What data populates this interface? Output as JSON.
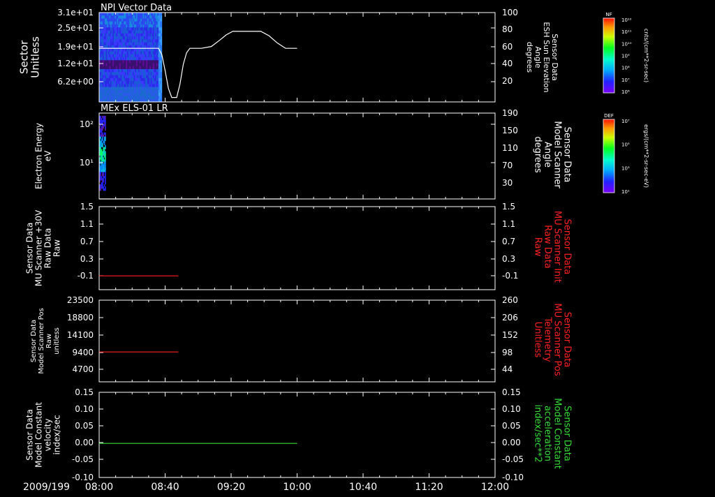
{
  "chart_data": [
    {
      "type": "heatmap",
      "title": "NPI Vector Data",
      "ylabel_lines": [
        "Sector",
        "Unitless"
      ],
      "ytick_labels": [
        "3.1e+01",
        "2.5e+01",
        "1.9e+01",
        "1.2e+01",
        "6.2e+00"
      ],
      "ylim": [
        0,
        31
      ],
      "right_ylabel_lines": [
        "Sensor Data",
        "ESH Sun Elevation",
        "Angle",
        "degrees"
      ],
      "right_ytick_labels": [
        "100",
        "80",
        "60",
        "40",
        "20"
      ],
      "right_ylim": [
        0,
        100
      ],
      "heatmap_x_range": [
        "08:00",
        "08:38"
      ],
      "overlay_line": {
        "color": "#ffffff",
        "points": [
          [
            "08:00",
            60
          ],
          [
            "08:36",
            60
          ],
          [
            "08:38",
            53
          ],
          [
            "08:40",
            35
          ],
          [
            "08:42",
            15
          ],
          [
            "08:44",
            5
          ],
          [
            "08:47",
            5
          ],
          [
            "08:49",
            20
          ],
          [
            "08:51",
            42
          ],
          [
            "08:53",
            55
          ],
          [
            "08:55",
            60
          ],
          [
            "09:02",
            60
          ],
          [
            "09:08",
            62
          ],
          [
            "09:13",
            69
          ],
          [
            "09:17",
            75
          ],
          [
            "09:21",
            79
          ],
          [
            "09:33",
            79
          ],
          [
            "09:38",
            79
          ],
          [
            "09:43",
            74
          ],
          [
            "09:48",
            66
          ],
          [
            "09:53",
            60
          ],
          [
            "10:00",
            60
          ]
        ]
      },
      "colorbar": {
        "label": "NF",
        "units": "cnts/(cm**2-sr-sec)",
        "tick_labels": [
          "10¹²",
          "10¹¹",
          "10¹⁰",
          "10⁹",
          "10⁸",
          "10⁷",
          "10⁶"
        ]
      }
    },
    {
      "type": "heatmap",
      "title": "MEx ELS-01 LR",
      "ylabel_lines": [
        "Electron Energy",
        "eV"
      ],
      "ytick_labels": [
        "10²",
        "10¹"
      ],
      "ylim_log10": [
        0.3,
        2.25
      ],
      "right_ylabel_lines": [
        "Sensor Data",
        "Model Scanner",
        "Angle",
        "degrees"
      ],
      "right_ytick_labels": [
        "190",
        "150",
        "110",
        "70",
        "30"
      ],
      "right_ylim": [
        10,
        190
      ],
      "heatmap_x_range": [
        "08:00",
        "08:04"
      ],
      "overlay_line": {
        "color": "#ffffff",
        "points": [
          [
            "08:00",
            10
          ],
          [
            "10:00",
            10
          ]
        ]
      },
      "colorbar": {
        "label": "DEF",
        "units": "ergs/(cm**2-sr-sec-eV)",
        "tick_labels": [
          "10⁷",
          "10⁵",
          "10³",
          "10¹"
        ]
      }
    },
    {
      "type": "line",
      "ylabel_lines": [
        "Sensor Data",
        "MU Scanner +30V",
        "Raw Data",
        "Raw"
      ],
      "ytick_labels": [
        "1.5",
        "1.1",
        "0.7",
        "0.3",
        "-0.1"
      ],
      "ylim": [
        -0.3,
        1.5
      ],
      "right_ylabel_lines": [
        "Sensor Data",
        "MU Scanner Init",
        "Raw Data",
        "Raw"
      ],
      "right_ytick_labels": [
        "1.5",
        "1.1",
        "0.7",
        "0.3",
        "-0.1"
      ],
      "series": [
        {
          "color": "#ff2020",
          "points": [
            [
              "08:00",
              0.0
            ],
            [
              "08:48",
              0.0
            ]
          ]
        }
      ]
    },
    {
      "type": "line",
      "ylabel_lines": [
        "Sensor Data",
        "Model Scanner Pos",
        "Raw",
        "unitless"
      ],
      "ytick_labels": [
        "23500",
        "18800",
        "14100",
        "9400",
        "4700"
      ],
      "ylim": [
        0,
        23500
      ],
      "right_ylabel_lines": [
        "Sensor Data",
        "MU Scanner Pos",
        "Telemetry",
        "Unitless"
      ],
      "right_ytick_labels": [
        "260",
        "206",
        "152",
        "98",
        "44"
      ],
      "series": [
        {
          "color": "#ff2020",
          "points": [
            [
              "08:00",
              8600
            ],
            [
              "08:48",
              8600
            ]
          ]
        }
      ]
    },
    {
      "type": "line",
      "ylabel_lines": [
        "Sensor Data",
        "Model Constant",
        "velocity",
        "index/sec"
      ],
      "ytick_labels": [
        "0.15",
        "0.10",
        "0.05",
        "0.00",
        "-0.05",
        "-0.10"
      ],
      "ylim": [
        -0.1,
        0.15
      ],
      "right_ylabel_lines": [
        "Sensor Data",
        "Model Constant",
        "acceleration",
        "index/sec**2"
      ],
      "right_ytick_labels": [
        "0.15",
        "0.10",
        "0.05",
        "0.00",
        "-0.05",
        "-0.10"
      ],
      "series": [
        {
          "color": "#33dd33",
          "points": [
            [
              "08:00",
              0.0
            ],
            [
              "10:00",
              0.0
            ]
          ]
        }
      ]
    }
  ],
  "x_axis": {
    "date_label": "2009/199",
    "range": [
      "08:00",
      "12:00"
    ],
    "tick_labels": [
      "08:00",
      "08:40",
      "09:20",
      "10:00",
      "10:40",
      "11:20",
      "12:00"
    ]
  },
  "colors": {
    "axis": "#ffffff",
    "right_label_red": "#ff2020",
    "right_label_green": "#33dd33"
  }
}
